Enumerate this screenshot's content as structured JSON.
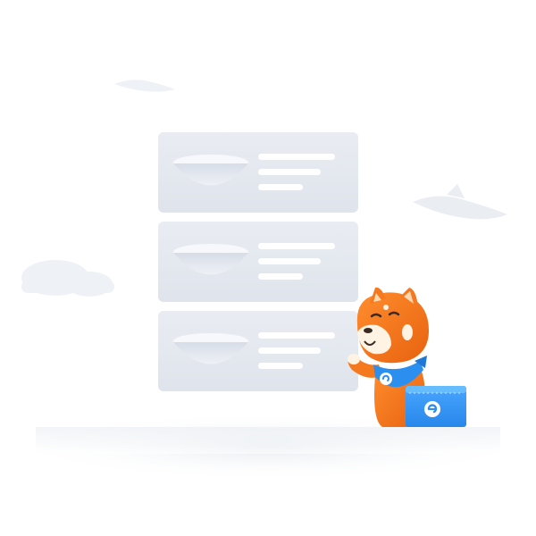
{
  "illustration": {
    "theme": "empty-state",
    "card_count": 3,
    "colors": {
      "card_fill": "#e3e7ee",
      "card_highlight": "#f4f6f9",
      "line_fill": "#ffffff",
      "mascot_orange": "#f57a1f",
      "mascot_dark": "#d9560f",
      "cream": "#fff3e3",
      "bag_blue": "#2b8ff0",
      "bag_top": "#4fb0ff",
      "cloud": "#eef1f5"
    },
    "icons": {
      "mascot": "shiba-mascot-icon",
      "delivery_bag": "delivery-bag-icon",
      "bowl": "bowl-icon",
      "logo": "e-logo-icon"
    }
  }
}
